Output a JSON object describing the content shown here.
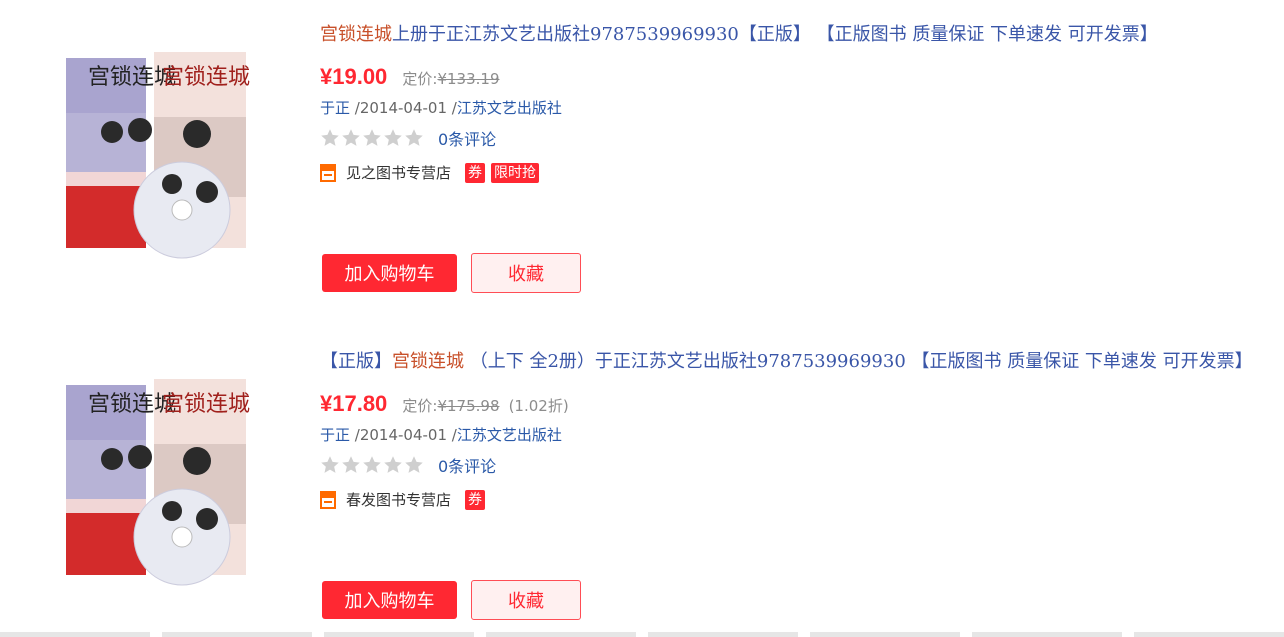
{
  "products": [
    {
      "title_highlight": "宫锁连城",
      "title_rest": "上册于正江苏文艺出版社9787539969930【正版】 【正版图书 质量保证 下单速发 可开发票】",
      "title_prefix": "",
      "price": "¥19.00",
      "orig_label": "定价:",
      "orig_price": "¥133.19",
      "discount": "",
      "author": "于正",
      "date": " /2014-04-01 /",
      "publisher": "江苏文艺出版社",
      "reviews": "0条评论",
      "shop": "见之图书专营店",
      "tags": [
        "券",
        "限时抢"
      ],
      "cart_label": "加入购物车",
      "fav_label": "收藏",
      "cover_text": "宫锁连城"
    },
    {
      "title_prefix": "【正版】",
      "title_highlight": "宫锁连城",
      "title_rest": " （上下 全2册）于正江苏文艺出版社9787539969930 【正版图书 质量保证 下单速发 可开发票】",
      "price": "¥17.80",
      "orig_label": "定价:",
      "orig_price": "¥175.98",
      "discount": "(1.02折)",
      "author": "于正",
      "date": " /2014-04-01 /",
      "publisher": "江苏文艺出版社",
      "reviews": "0条评论",
      "shop": "春发图书专营店",
      "tags": [
        "券"
      ],
      "cart_label": "加入购物车",
      "fav_label": "收藏",
      "cover_text": "宫锁连城"
    }
  ],
  "colors": {
    "price": "#ff2832",
    "link": "#2a59a8",
    "highlight": "#c8502a",
    "shop_icon": "#ff6a00"
  }
}
